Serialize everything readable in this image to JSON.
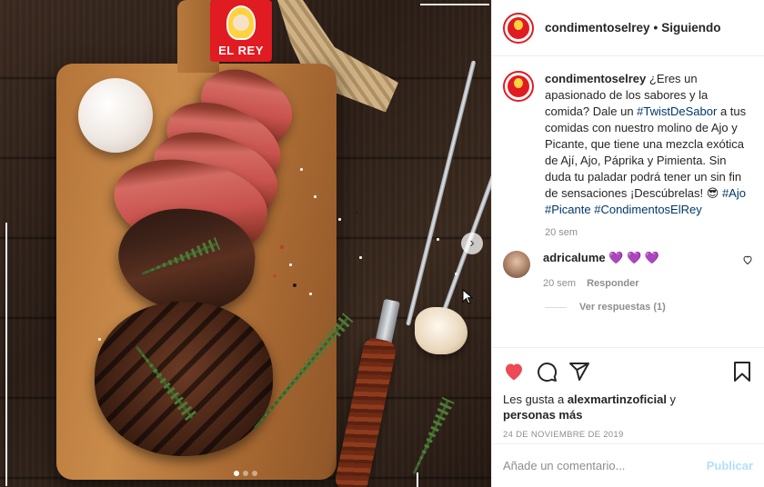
{
  "brand": {
    "logo_text": "EL REY",
    "accent": "#e11b22",
    "link_color": "#00376b",
    "like_color": "#ed4956"
  },
  "post": {
    "username": "condimentoselrey",
    "separator": "•",
    "follow_status": "Siguiendo",
    "caption_parts": {
      "p1": "¿Eres un apasionado de los sabores y la comida? Dale un ",
      "tag1": "#TwistDeSabor",
      "p2": " a tus comidas con nuestro molino de Ajo y Picante, que tiene una mezcla exótica de Ají, Ajo, Páprika y Pimienta. Sin duda tu paladar podrá tener un sin fin de sensaciones ¡Descúbrelas! 😎  ",
      "tag2": "#Ajo",
      "tag3": "#Picante",
      "tag4": "#CondimentosElRey"
    },
    "caption_time": "20 sem",
    "carousel": {
      "slides": 3,
      "active": 1,
      "next_icon": "chevron-right-icon"
    }
  },
  "comments": [
    {
      "username": "adricalume",
      "text": "💜 💜 💜",
      "time": "20 sem",
      "reply_label": "Responder",
      "like_icon": "heart-outline-icon"
    }
  ],
  "view_replies": "Ver respuestas (1)",
  "actions": {
    "like_icon": "heart-filled-icon",
    "comment_icon": "comment-icon",
    "share_icon": "send-icon",
    "save_icon": "bookmark-icon"
  },
  "likes": {
    "prefix": "Les gusta a ",
    "user": "alexmartinzoficial",
    "suffix": " y",
    "others": "personas más"
  },
  "date": "24 DE NOVIEMBRE DE 2019",
  "add_comment": {
    "placeholder": "Añade un comentario...",
    "publish_label": "Publicar"
  }
}
